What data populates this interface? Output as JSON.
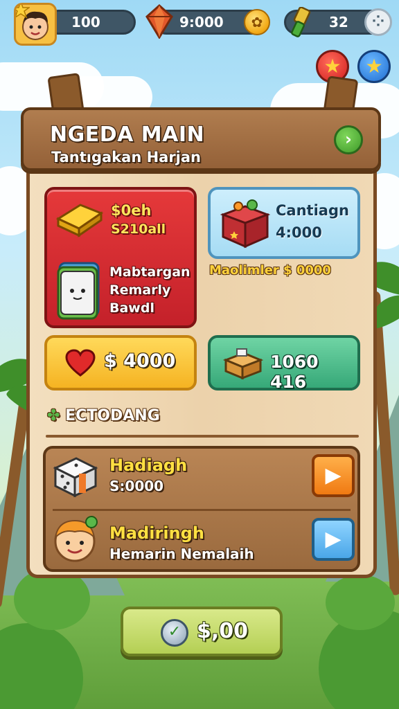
{
  "topbar": {
    "lives_value": "100",
    "gems_value": "9:000",
    "tokens_value": "32",
    "gems_coin_icon": "coin-icon",
    "menu_icon": "grid-menu-icon"
  },
  "header": {
    "title": "NGEDA MAIN",
    "subtitle": "Tantıgakan Harjan"
  },
  "cards": {
    "red": {
      "line1": "$0eh",
      "line2": "S210all",
      "item_line1": "Mabtargan",
      "item_line2": "Remarly",
      "item_line3": "Bawdl"
    },
    "blue": {
      "line1": "Cantiagn",
      "line2": "4:000"
    },
    "blue_caption": "Maolimler $ 0000",
    "yellow_value": "$ 4000",
    "green_value": "1060 416"
  },
  "section": {
    "title": "ECTODANG"
  },
  "rewards": [
    {
      "title": "Hadiagh",
      "subtitle": "S:0000"
    },
    {
      "title": "Madiringh",
      "subtitle": "Hemarin Nemalaih"
    }
  ],
  "bottom_button": {
    "label": "$,00"
  },
  "colors": {
    "accent_red": "#c4212a",
    "accent_blue": "#a6dcf4",
    "accent_yellow": "#f5b322",
    "accent_green": "#36a878",
    "wood": "#946138"
  }
}
